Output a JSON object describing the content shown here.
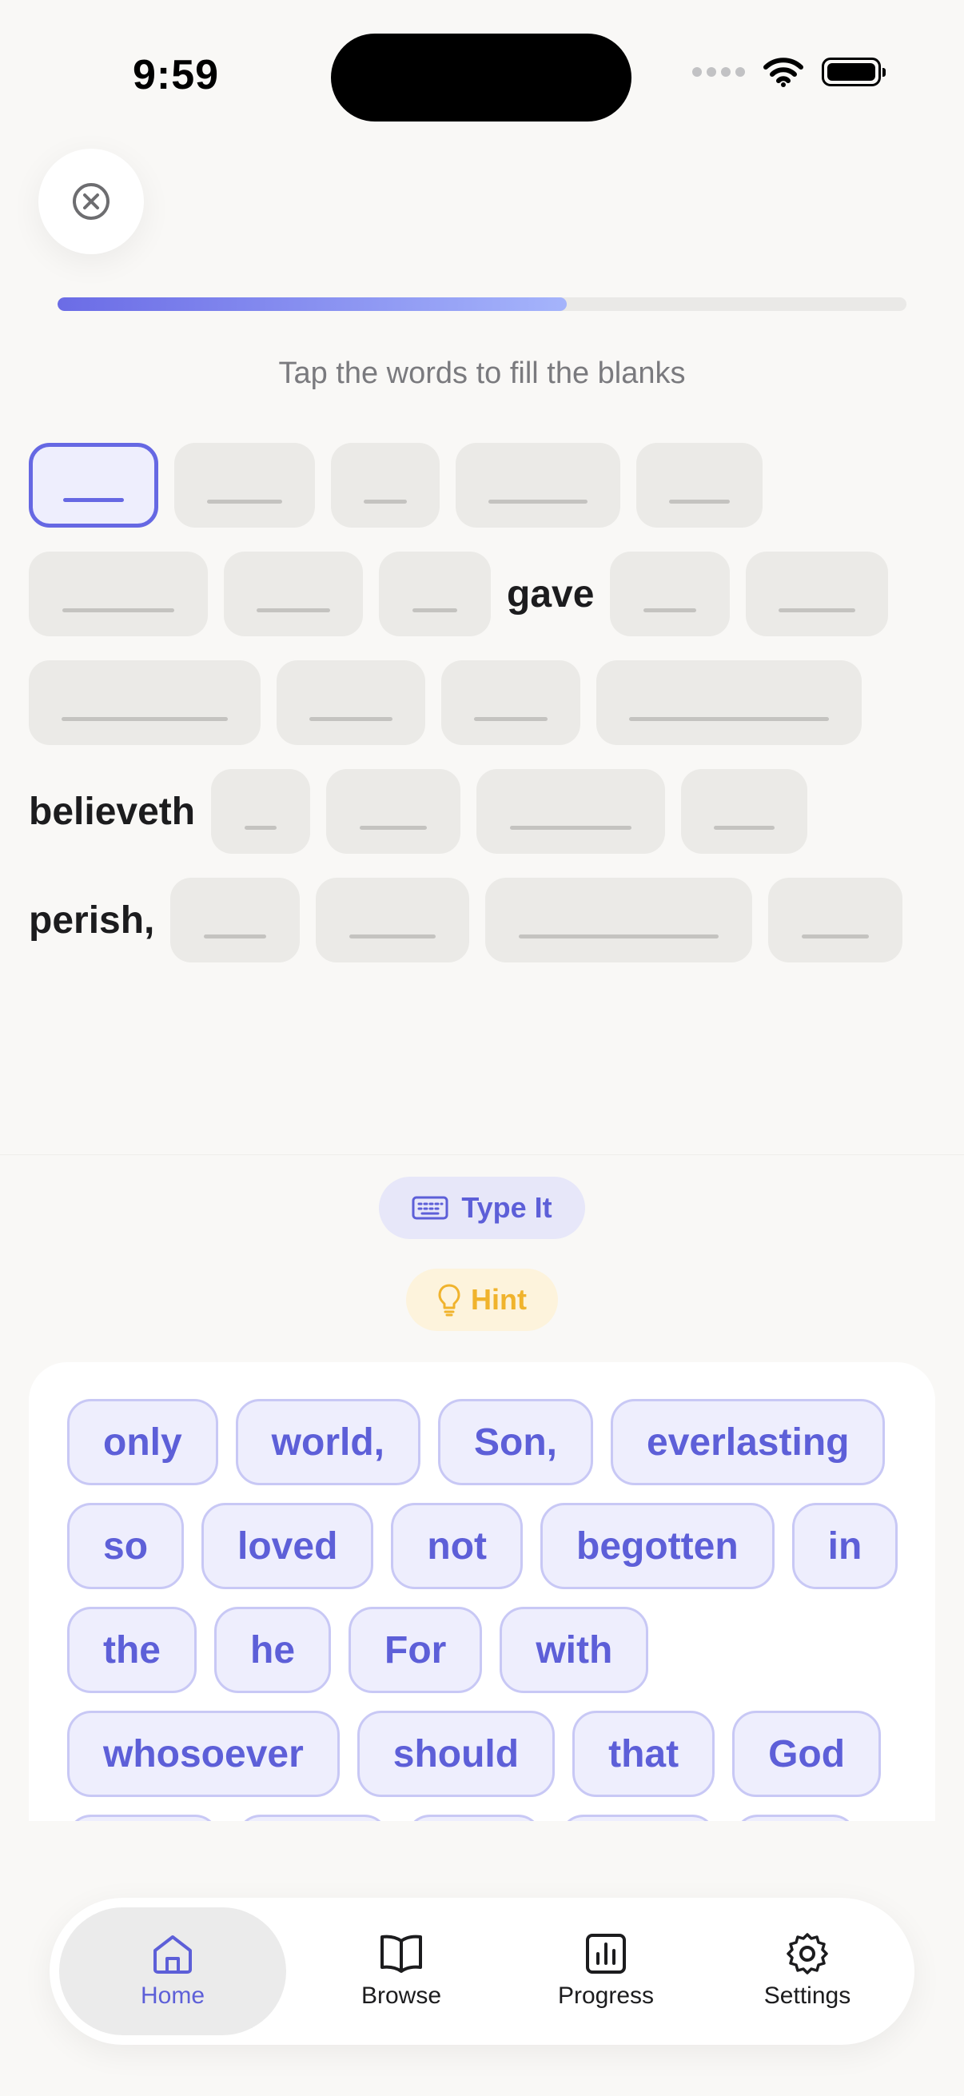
{
  "status_bar": {
    "time": "9:59"
  },
  "exercise": {
    "progress_percent": 60,
    "instruction": "Tap the words to fill the blanks"
  },
  "verse": {
    "words": [
      "gave",
      "believeth",
      "perish,"
    ]
  },
  "actions": {
    "type_it_label": "Type It",
    "hint_label": "Hint"
  },
  "word_bank": {
    "rows": [
      [
        "only",
        "world,",
        "Son,",
        "everlasting"
      ],
      [
        "so",
        "loved",
        "not",
        "begotten",
        "in"
      ],
      [
        "the",
        "he",
        "For",
        "with"
      ],
      [
        "whosoever",
        "should",
        "that",
        "God"
      ]
    ]
  },
  "tabs": [
    {
      "label": "Home",
      "icon": "home-icon",
      "active": true
    },
    {
      "label": "Browse",
      "icon": "book-icon",
      "active": false
    },
    {
      "label": "Progress",
      "icon": "chart-icon",
      "active": false
    },
    {
      "label": "Settings",
      "icon": "gear-icon",
      "active": false
    }
  ],
  "colors": {
    "accent": "#5d5fd8",
    "hint": "#f0b32d",
    "blank": "#ebeae7"
  }
}
